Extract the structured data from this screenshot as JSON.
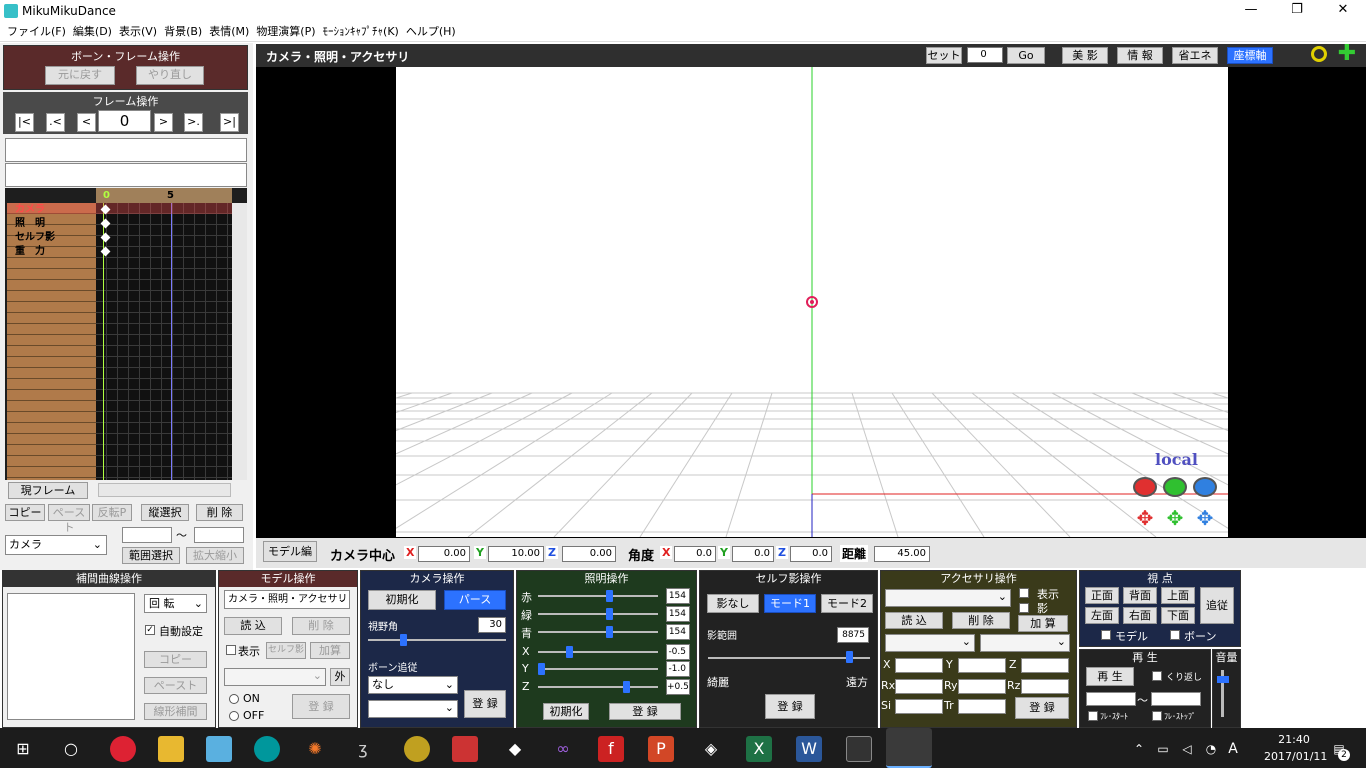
{
  "window": {
    "title": "MikuMikuDance",
    "minimize": "—",
    "maximize": "❐",
    "close": "✕"
  },
  "menu": [
    "ファイル(F)",
    "編集(D)",
    "表示(V)",
    "背景(B)",
    "表情(M)",
    "物理演算(P)",
    "ﾓｰｼｮﾝｷｬﾌﾟﾁｬ(K)",
    "ヘルプ(H)"
  ],
  "bone_frame": {
    "title": "ボーン・フレーム操作",
    "undo": "元に戻す",
    "redo": "やり直し"
  },
  "frame_ops": {
    "title": "フレーム操作",
    "first": "|<",
    "prev_key": ".<",
    "prev": "<",
    "frame": "0",
    "next": ">",
    "next_key": ">.",
    "last": ">|"
  },
  "timeline": {
    "tick0": "0",
    "tick5": "5",
    "rows": [
      "カメラ",
      "照　明",
      "セルフ影",
      "重　力"
    ]
  },
  "left_bottom": {
    "current_frame": "現フレーム",
    "copy": "コピー",
    "paste": "ペースト",
    "invert": "反転P",
    "vsel": "縦選択",
    "delete": "削 除",
    "model_select": "カメラ",
    "tilde": "～",
    "range_select": "範囲選択",
    "scale": "拡大縮小"
  },
  "viewport": {
    "title": "カメラ・照明・アクセサリ",
    "set": "セット",
    "set_value": "0",
    "go": "Go",
    "beauty_shadow": "美 影",
    "info": "情 報",
    "eco": "省エネ",
    "axis": "座標軸",
    "local": "local"
  },
  "camera_row": {
    "model_edit": "モデル編",
    "center": "カメラ中心",
    "x": "0.00",
    "y": "10.00",
    "z": "0.00",
    "angle": "角度",
    "ax": "0.0",
    "ay": "0.0",
    "az": "0.0",
    "distance": "距離",
    "dist": "45.00",
    "X": "X",
    "Y": "Y",
    "Z": "Z"
  },
  "interp": {
    "title": "補間曲線操作",
    "mode": "回 転",
    "auto": "自動設定",
    "copy": "コピー",
    "paste": "ペースト",
    "linear": "線形補間"
  },
  "model_ops": {
    "title": "モデル操作",
    "selected": "カメラ・照明・アクセサリ",
    "load": "読 込",
    "delete": "削 除",
    "show": "表示",
    "self_shadow": "セルフ影",
    "add": "加算",
    "outer": "外",
    "on": "ON",
    "off": "OFF",
    "register": "登 録"
  },
  "camera_ops": {
    "title": "カメラ操作",
    "init": "初期化",
    "perspective": "パース",
    "fov_label": "視野角",
    "fov": "30",
    "bone_follow": "ボーン追従",
    "follow": "なし",
    "register": "登 録"
  },
  "light_ops": {
    "title": "照明操作",
    "r_label": "赤",
    "g_label": "緑",
    "b_label": "青",
    "r": "154",
    "g": "154",
    "b": "154",
    "x_label": "X",
    "y_label": "Y",
    "z_label": "Z",
    "x": "-0.5",
    "y": "-1.0",
    "z": "+0.5",
    "init": "初期化",
    "register": "登 録",
    "r_fill": 0.6,
    "g_fill": 0.6,
    "b_fill": 0.6,
    "x_fill": 0.25,
    "y_fill": 0.0,
    "z_fill": 0.75
  },
  "shadow_ops": {
    "title": "セルフ影操作",
    "none": "影なし",
    "mode1": "モード1",
    "mode2": "モード2",
    "range_label": "影範囲",
    "range": "8875",
    "fine": "綺麗",
    "far": "遠方",
    "register": "登 録",
    "range_fill": 0.89
  },
  "accessory_ops": {
    "title": "アクセサリ操作",
    "show": "表示",
    "shadow": "影",
    "load": "読 込",
    "delete": "削 除",
    "add": "加 算",
    "x": "X",
    "y": "Y",
    "z": "Z",
    "rx": "Rx",
    "ry": "Ry",
    "rz": "Rz",
    "si": "Si",
    "tr": "Tr",
    "register": "登 録"
  },
  "view_ops": {
    "title": "視 点",
    "front": "正面",
    "back": "背面",
    "top": "上面",
    "left": "左面",
    "right": "右面",
    "bottom": "下面",
    "follow": "追従",
    "model": "モデル",
    "bone": "ボーン"
  },
  "play": {
    "title": "再 生",
    "play": "再 生",
    "loop": "くり返し",
    "tilde": "～",
    "frame_start": "ﾌﾚ･ｽﾀｰﾄ",
    "frame_stop": "ﾌﾚ･ｽﾄｯﾌﾟ"
  },
  "volume": {
    "title": "音量",
    "level": 0.15
  },
  "taskbar": {
    "time": "21:40",
    "date": "2017/01/11",
    "ime": "A",
    "notif": "2",
    "colors": {
      "accent": "#2c72ff",
      "maroon": "#5a2a2a"
    }
  }
}
